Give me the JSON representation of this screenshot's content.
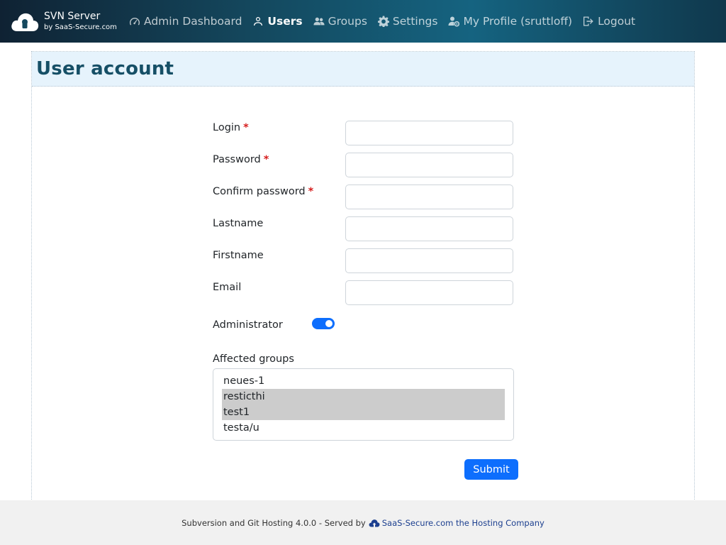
{
  "brand": {
    "title": "SVN Server",
    "subtitle": "by SaaS-Secure.com",
    "logo_icon": "cloud-lock-icon"
  },
  "nav": {
    "items": [
      {
        "label": "Admin Dashboard",
        "icon": "dashboard-gauge-icon"
      },
      {
        "label": "Users",
        "icon": "user-icon",
        "active": true
      },
      {
        "label": "Groups",
        "icon": "users-group-icon"
      },
      {
        "label": "Settings",
        "icon": "gear-icon"
      },
      {
        "label": "My Profile (sruttloff)",
        "icon": "user-gear-icon"
      },
      {
        "label": "Logout",
        "icon": "logout-icon"
      }
    ]
  },
  "page": {
    "title": "User account"
  },
  "form": {
    "login_label": "Login",
    "password_label": "Password",
    "confirm_password_label": "Confirm password",
    "lastname_label": "Lastname",
    "firstname_label": "Firstname",
    "email_label": "Email",
    "required_marker": "*",
    "administrator_label": "Administrator",
    "administrator_on": true,
    "groups_label": "Affected groups",
    "groups": [
      {
        "label": "neues-1",
        "selected": false
      },
      {
        "label": "resticthi",
        "selected": true
      },
      {
        "label": "test1",
        "selected": true
      },
      {
        "label": "testa/u",
        "selected": false
      }
    ],
    "submit_label": "Submit"
  },
  "footer": {
    "text": "Subversion and Git Hosting 4.0.0 - Served by",
    "link_text": "SaaS-Secure.com the Hosting Company",
    "link_icon": "cloud-upload-icon"
  },
  "colors": {
    "accent": "#0d6efd",
    "title": "#164f66",
    "required": "#d61e1e",
    "header_bg": "#e6f3fc"
  }
}
